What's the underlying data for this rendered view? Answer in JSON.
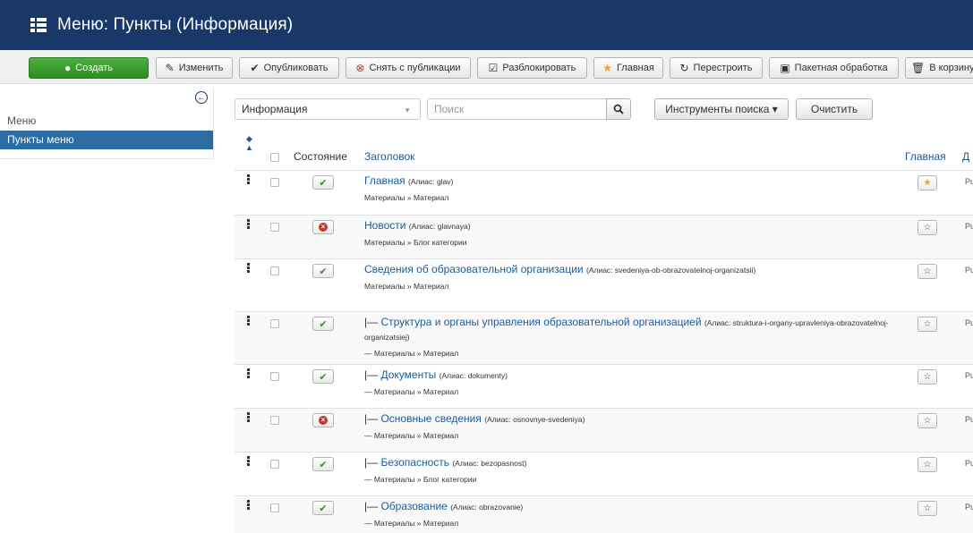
{
  "header": {
    "title": "Меню: Пункты (Информация)"
  },
  "toolbar": {
    "buttons": [
      {
        "label": "Создать",
        "icon": "plus-circle-icon"
      },
      {
        "label": "Изменить",
        "icon": "edit-icon"
      },
      {
        "label": "Опубликовать",
        "icon": "check-icon"
      },
      {
        "label": "Снять с публикации",
        "icon": "remove-circle-icon"
      },
      {
        "label": "Разблокировать",
        "icon": "checkbox-icon"
      },
      {
        "label": "Главная",
        "icon": "star-icon"
      },
      {
        "label": "Перестроить",
        "icon": "refresh-icon"
      },
      {
        "label": "Пакетная обработка",
        "icon": "batch-icon"
      },
      {
        "label": "В корзину",
        "icon": "trash-icon"
      }
    ]
  },
  "sidebar": {
    "items": [
      {
        "label": "Меню",
        "active": false
      },
      {
        "label": "Пункты меню",
        "active": true
      }
    ]
  },
  "filters": {
    "menu_select": "Информация",
    "search_placeholder": "Поиск",
    "tools_label": "Инструменты поиска ▾",
    "clear_label": "Очистить"
  },
  "table": {
    "headers": {
      "state": "Состояние",
      "title": "Заголовок",
      "home": "Главная",
      "access": "Д"
    },
    "rows": [
      {
        "title": "Главная",
        "alias": "(Алиас: glav)",
        "sub": "Материалы » Материал",
        "published": true,
        "home": true,
        "access": "Pu"
      },
      {
        "title": "Новости",
        "alias": "(Алиас: glavnaya)",
        "sub": "Материалы » Блог категории",
        "published": false,
        "home": false,
        "access": "Pu"
      },
      {
        "title": "Сведения об образовательной организации",
        "alias": "(Алиас: svedeniya-ob-obrazovatelnoj-organizatsii)",
        "sub": "Материалы » Материал",
        "published": true,
        "home": false,
        "access": "Pu"
      },
      {
        "prefix": "|— ",
        "title": "Структура и органы управления образовательной организацией",
        "alias": "(Алиас: struktura-i-organy-upravleniya-obrazovatelnoj-organizatsiej)",
        "sub": "— Материалы » Материал",
        "published": true,
        "home": false,
        "access": "Pu"
      },
      {
        "prefix": "|— ",
        "title": "Документы",
        "alias": "(Алиас: dokumenty)",
        "sub": "— Материалы » Материал",
        "published": true,
        "home": false,
        "access": "Pu"
      },
      {
        "prefix": "|— ",
        "title": "Основные сведения",
        "alias": "(Алиас: osnovnye-svedeniya)",
        "sub": "— Материалы » Материал",
        "published": false,
        "home": false,
        "access": "Pu"
      },
      {
        "prefix": "|— ",
        "title": "Безопасность",
        "alias": "(Алиас: bezopasnost)",
        "sub": "— Материалы » Блог категории",
        "published": true,
        "home": false,
        "access": "Pu"
      },
      {
        "prefix": "|— ",
        "title": "Образование",
        "alias": "(Алиас: obrazovanie)",
        "sub": "— Материалы » Материал",
        "published": true,
        "home": false,
        "access": "Pu"
      }
    ]
  },
  "colors": {
    "header_bg": "#1a3867",
    "accent": "#2d6ca2",
    "link": "#1a5b9c",
    "create_green": "#3c9e30"
  }
}
